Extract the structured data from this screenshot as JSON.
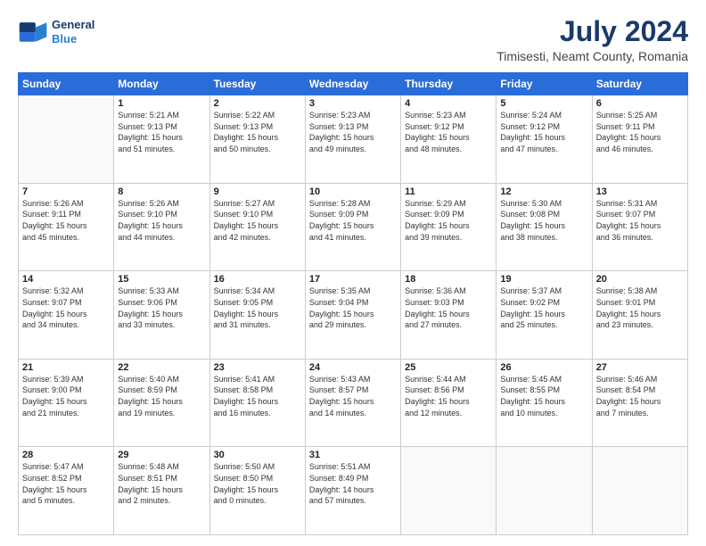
{
  "header": {
    "logo_line1": "General",
    "logo_line2": "Blue",
    "month_year": "July 2024",
    "location": "Timisesti, Neamt County, Romania"
  },
  "weekdays": [
    "Sunday",
    "Monday",
    "Tuesday",
    "Wednesday",
    "Thursday",
    "Friday",
    "Saturday"
  ],
  "weeks": [
    [
      {
        "day": "",
        "sunrise": "",
        "sunset": "",
        "daylight": ""
      },
      {
        "day": "1",
        "sunrise": "Sunrise: 5:21 AM",
        "sunset": "Sunset: 9:13 PM",
        "daylight": "Daylight: 15 hours and 51 minutes."
      },
      {
        "day": "2",
        "sunrise": "Sunrise: 5:22 AM",
        "sunset": "Sunset: 9:13 PM",
        "daylight": "Daylight: 15 hours and 50 minutes."
      },
      {
        "day": "3",
        "sunrise": "Sunrise: 5:23 AM",
        "sunset": "Sunset: 9:13 PM",
        "daylight": "Daylight: 15 hours and 49 minutes."
      },
      {
        "day": "4",
        "sunrise": "Sunrise: 5:23 AM",
        "sunset": "Sunset: 9:12 PM",
        "daylight": "Daylight: 15 hours and 48 minutes."
      },
      {
        "day": "5",
        "sunrise": "Sunrise: 5:24 AM",
        "sunset": "Sunset: 9:12 PM",
        "daylight": "Daylight: 15 hours and 47 minutes."
      },
      {
        "day": "6",
        "sunrise": "Sunrise: 5:25 AM",
        "sunset": "Sunset: 9:11 PM",
        "daylight": "Daylight: 15 hours and 46 minutes."
      }
    ],
    [
      {
        "day": "7",
        "sunrise": "Sunrise: 5:26 AM",
        "sunset": "Sunset: 9:11 PM",
        "daylight": "Daylight: 15 hours and 45 minutes."
      },
      {
        "day": "8",
        "sunrise": "Sunrise: 5:26 AM",
        "sunset": "Sunset: 9:10 PM",
        "daylight": "Daylight: 15 hours and 44 minutes."
      },
      {
        "day": "9",
        "sunrise": "Sunrise: 5:27 AM",
        "sunset": "Sunset: 9:10 PM",
        "daylight": "Daylight: 15 hours and 42 minutes."
      },
      {
        "day": "10",
        "sunrise": "Sunrise: 5:28 AM",
        "sunset": "Sunset: 9:09 PM",
        "daylight": "Daylight: 15 hours and 41 minutes."
      },
      {
        "day": "11",
        "sunrise": "Sunrise: 5:29 AM",
        "sunset": "Sunset: 9:09 PM",
        "daylight": "Daylight: 15 hours and 39 minutes."
      },
      {
        "day": "12",
        "sunrise": "Sunrise: 5:30 AM",
        "sunset": "Sunset: 9:08 PM",
        "daylight": "Daylight: 15 hours and 38 minutes."
      },
      {
        "day": "13",
        "sunrise": "Sunrise: 5:31 AM",
        "sunset": "Sunset: 9:07 PM",
        "daylight": "Daylight: 15 hours and 36 minutes."
      }
    ],
    [
      {
        "day": "14",
        "sunrise": "Sunrise: 5:32 AM",
        "sunset": "Sunset: 9:07 PM",
        "daylight": "Daylight: 15 hours and 34 minutes."
      },
      {
        "day": "15",
        "sunrise": "Sunrise: 5:33 AM",
        "sunset": "Sunset: 9:06 PM",
        "daylight": "Daylight: 15 hours and 33 minutes."
      },
      {
        "day": "16",
        "sunrise": "Sunrise: 5:34 AM",
        "sunset": "Sunset: 9:05 PM",
        "daylight": "Daylight: 15 hours and 31 minutes."
      },
      {
        "day": "17",
        "sunrise": "Sunrise: 5:35 AM",
        "sunset": "Sunset: 9:04 PM",
        "daylight": "Daylight: 15 hours and 29 minutes."
      },
      {
        "day": "18",
        "sunrise": "Sunrise: 5:36 AM",
        "sunset": "Sunset: 9:03 PM",
        "daylight": "Daylight: 15 hours and 27 minutes."
      },
      {
        "day": "19",
        "sunrise": "Sunrise: 5:37 AM",
        "sunset": "Sunset: 9:02 PM",
        "daylight": "Daylight: 15 hours and 25 minutes."
      },
      {
        "day": "20",
        "sunrise": "Sunrise: 5:38 AM",
        "sunset": "Sunset: 9:01 PM",
        "daylight": "Daylight: 15 hours and 23 minutes."
      }
    ],
    [
      {
        "day": "21",
        "sunrise": "Sunrise: 5:39 AM",
        "sunset": "Sunset: 9:00 PM",
        "daylight": "Daylight: 15 hours and 21 minutes."
      },
      {
        "day": "22",
        "sunrise": "Sunrise: 5:40 AM",
        "sunset": "Sunset: 8:59 PM",
        "daylight": "Daylight: 15 hours and 19 minutes."
      },
      {
        "day": "23",
        "sunrise": "Sunrise: 5:41 AM",
        "sunset": "Sunset: 8:58 PM",
        "daylight": "Daylight: 15 hours and 16 minutes."
      },
      {
        "day": "24",
        "sunrise": "Sunrise: 5:43 AM",
        "sunset": "Sunset: 8:57 PM",
        "daylight": "Daylight: 15 hours and 14 minutes."
      },
      {
        "day": "25",
        "sunrise": "Sunrise: 5:44 AM",
        "sunset": "Sunset: 8:56 PM",
        "daylight": "Daylight: 15 hours and 12 minutes."
      },
      {
        "day": "26",
        "sunrise": "Sunrise: 5:45 AM",
        "sunset": "Sunset: 8:55 PM",
        "daylight": "Daylight: 15 hours and 10 minutes."
      },
      {
        "day": "27",
        "sunrise": "Sunrise: 5:46 AM",
        "sunset": "Sunset: 8:54 PM",
        "daylight": "Daylight: 15 hours and 7 minutes."
      }
    ],
    [
      {
        "day": "28",
        "sunrise": "Sunrise: 5:47 AM",
        "sunset": "Sunset: 8:52 PM",
        "daylight": "Daylight: 15 hours and 5 minutes."
      },
      {
        "day": "29",
        "sunrise": "Sunrise: 5:48 AM",
        "sunset": "Sunset: 8:51 PM",
        "daylight": "Daylight: 15 hours and 2 minutes."
      },
      {
        "day": "30",
        "sunrise": "Sunrise: 5:50 AM",
        "sunset": "Sunset: 8:50 PM",
        "daylight": "Daylight: 15 hours and 0 minutes."
      },
      {
        "day": "31",
        "sunrise": "Sunrise: 5:51 AM",
        "sunset": "Sunset: 8:49 PM",
        "daylight": "Daylight: 14 hours and 57 minutes."
      },
      {
        "day": "",
        "sunrise": "",
        "sunset": "",
        "daylight": ""
      },
      {
        "day": "",
        "sunrise": "",
        "sunset": "",
        "daylight": ""
      },
      {
        "day": "",
        "sunrise": "",
        "sunset": "",
        "daylight": ""
      }
    ]
  ]
}
